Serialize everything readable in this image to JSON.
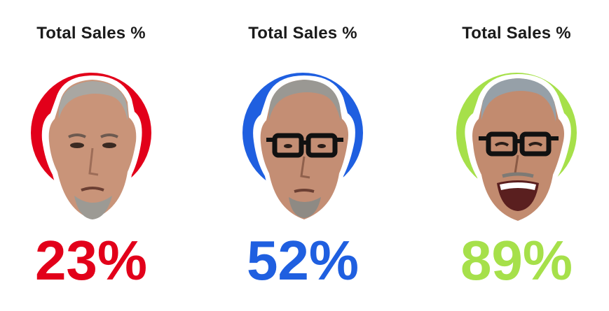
{
  "cards": [
    {
      "title": "Total Sales %",
      "value": "23%",
      "color": "#e2001a",
      "face_expression": "stern",
      "glasses": false
    },
    {
      "title": "Total Sales %",
      "value": "52%",
      "color": "#1f5fe0",
      "face_expression": "neutral",
      "glasses": true
    },
    {
      "title": "Total Sales %",
      "value": "89%",
      "color": "#a6e04a",
      "face_expression": "laughing",
      "glasses": true
    }
  ]
}
